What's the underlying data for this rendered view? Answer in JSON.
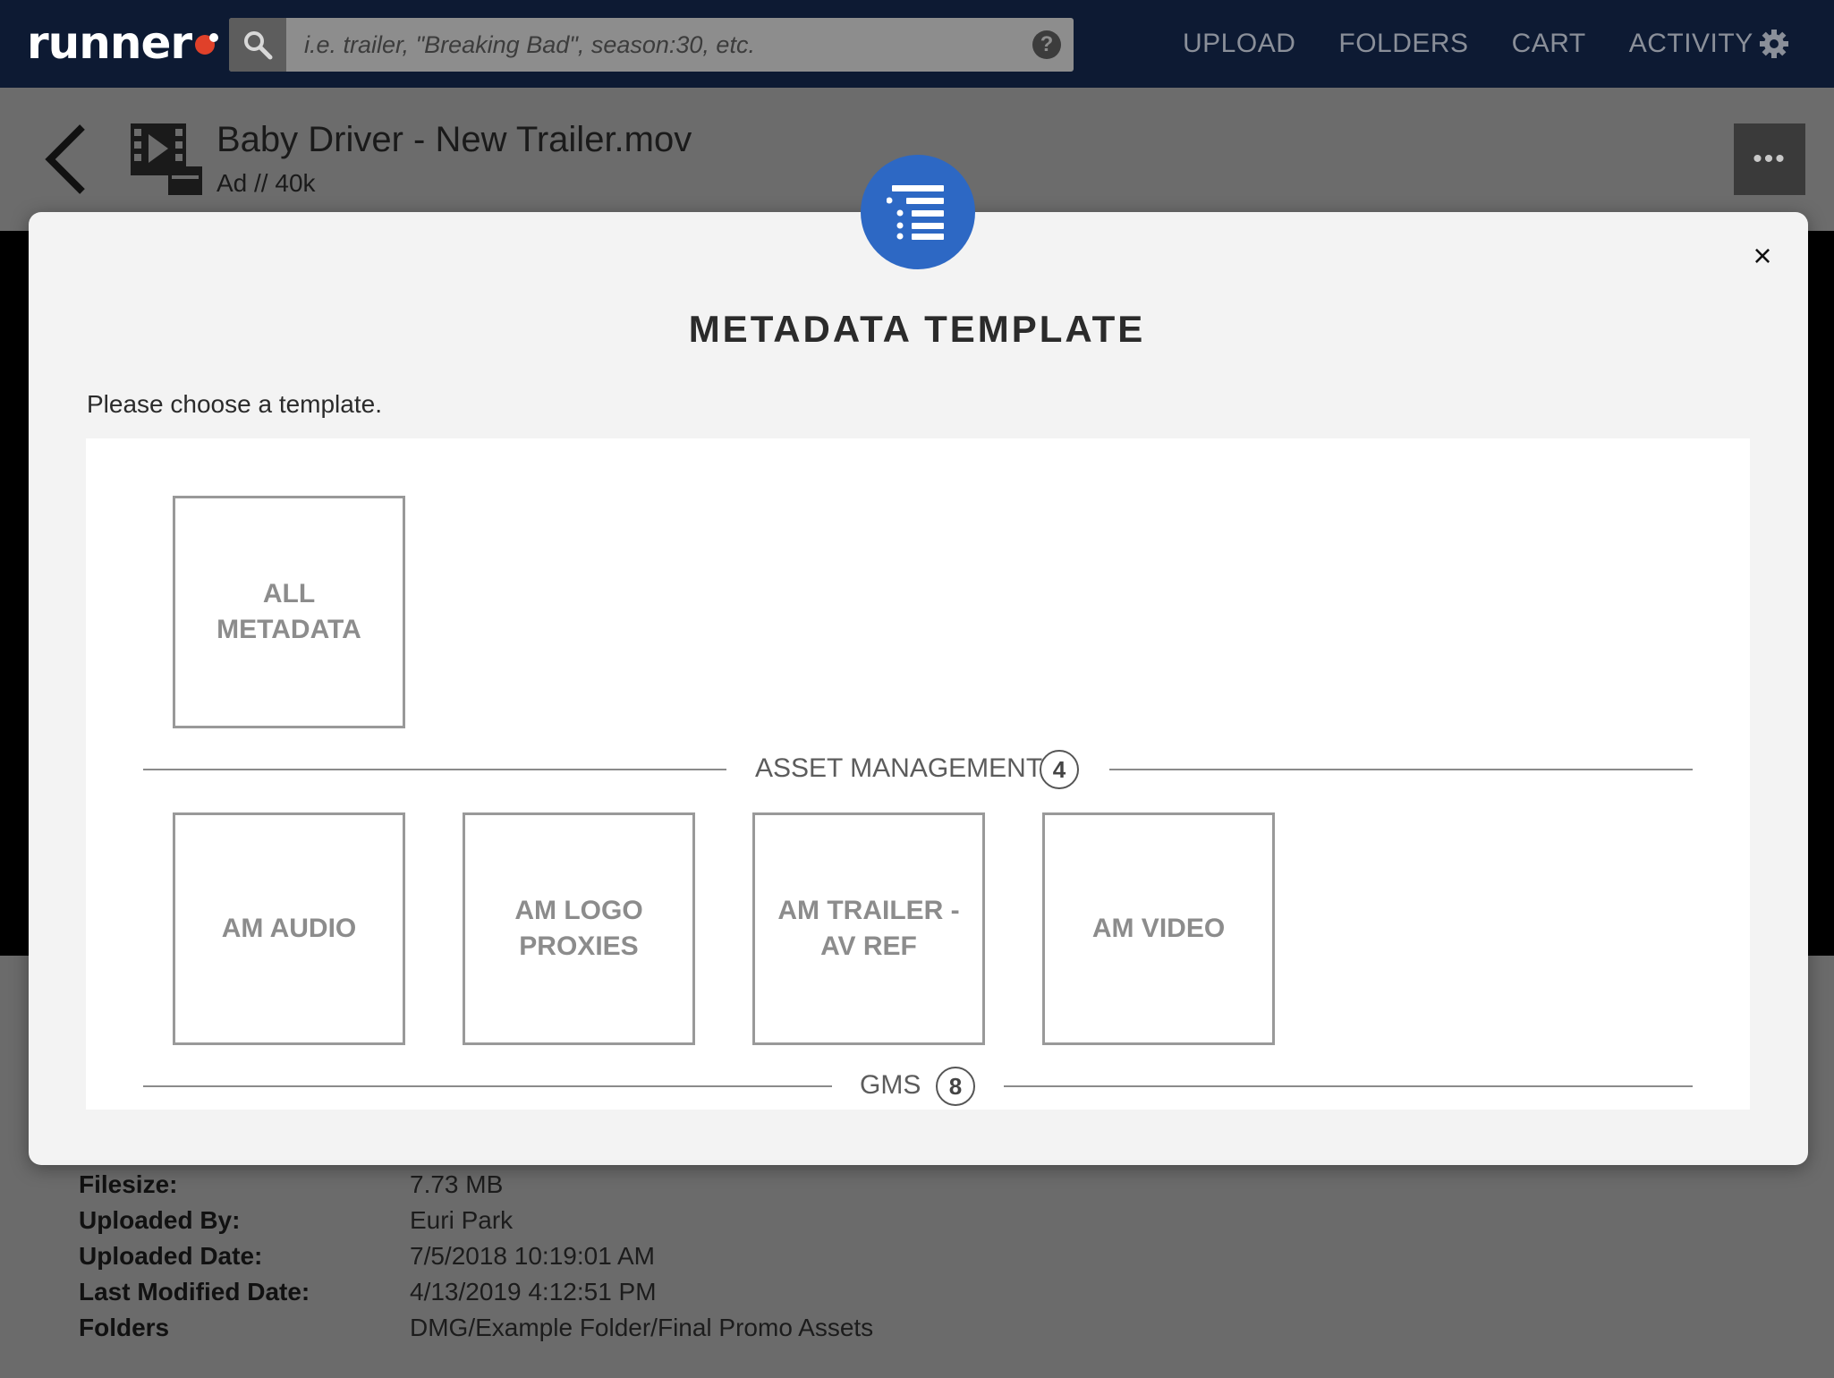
{
  "app": {
    "logo_text": "runner"
  },
  "search": {
    "placeholder": "i.e. trailer, \"Breaking Bad\", season:30, etc.",
    "help_label": "?"
  },
  "nav": {
    "items": [
      "UPLOAD",
      "FOLDERS",
      "CART",
      "ACTIVITY"
    ]
  },
  "file": {
    "title": "Baby Driver - New Trailer.mov",
    "subtitle": "Ad // 40k",
    "more_label": "•••"
  },
  "modal": {
    "title": "METADATA TEMPLATE",
    "subtitle": "Please choose a template.",
    "close_label": "×",
    "all_tile": {
      "line1": "ALL",
      "line2": "METADATA"
    },
    "sections": [
      {
        "label": "ASSET MANAGEMENT",
        "count": "4",
        "tiles": [
          {
            "line1": "AM AUDIO",
            "line2": ""
          },
          {
            "line1": "AM LOGO",
            "line2": "PROXIES"
          },
          {
            "line1": "AM TRAILER -",
            "line2": "AV REF"
          },
          {
            "line1": "AM VIDEO",
            "line2": ""
          }
        ]
      },
      {
        "label": "GMS",
        "count": "8",
        "tiles": []
      }
    ]
  },
  "details": [
    {
      "key": "Filesize:",
      "value": "7.73 MB"
    },
    {
      "key": "Uploaded By:",
      "value": "Euri Park"
    },
    {
      "key": "Uploaded Date:",
      "value": "7/5/2018 10:19:01 AM"
    },
    {
      "key": "Last Modified Date:",
      "value": "4/13/2019 4:12:51 PM"
    },
    {
      "key": "Folders",
      "value": "DMG/Example Folder/Final Promo Assets"
    }
  ],
  "colors": {
    "nav_bg": "#0d1a33",
    "accent": "#2d68c4",
    "logo_mark": "#e0412a"
  }
}
